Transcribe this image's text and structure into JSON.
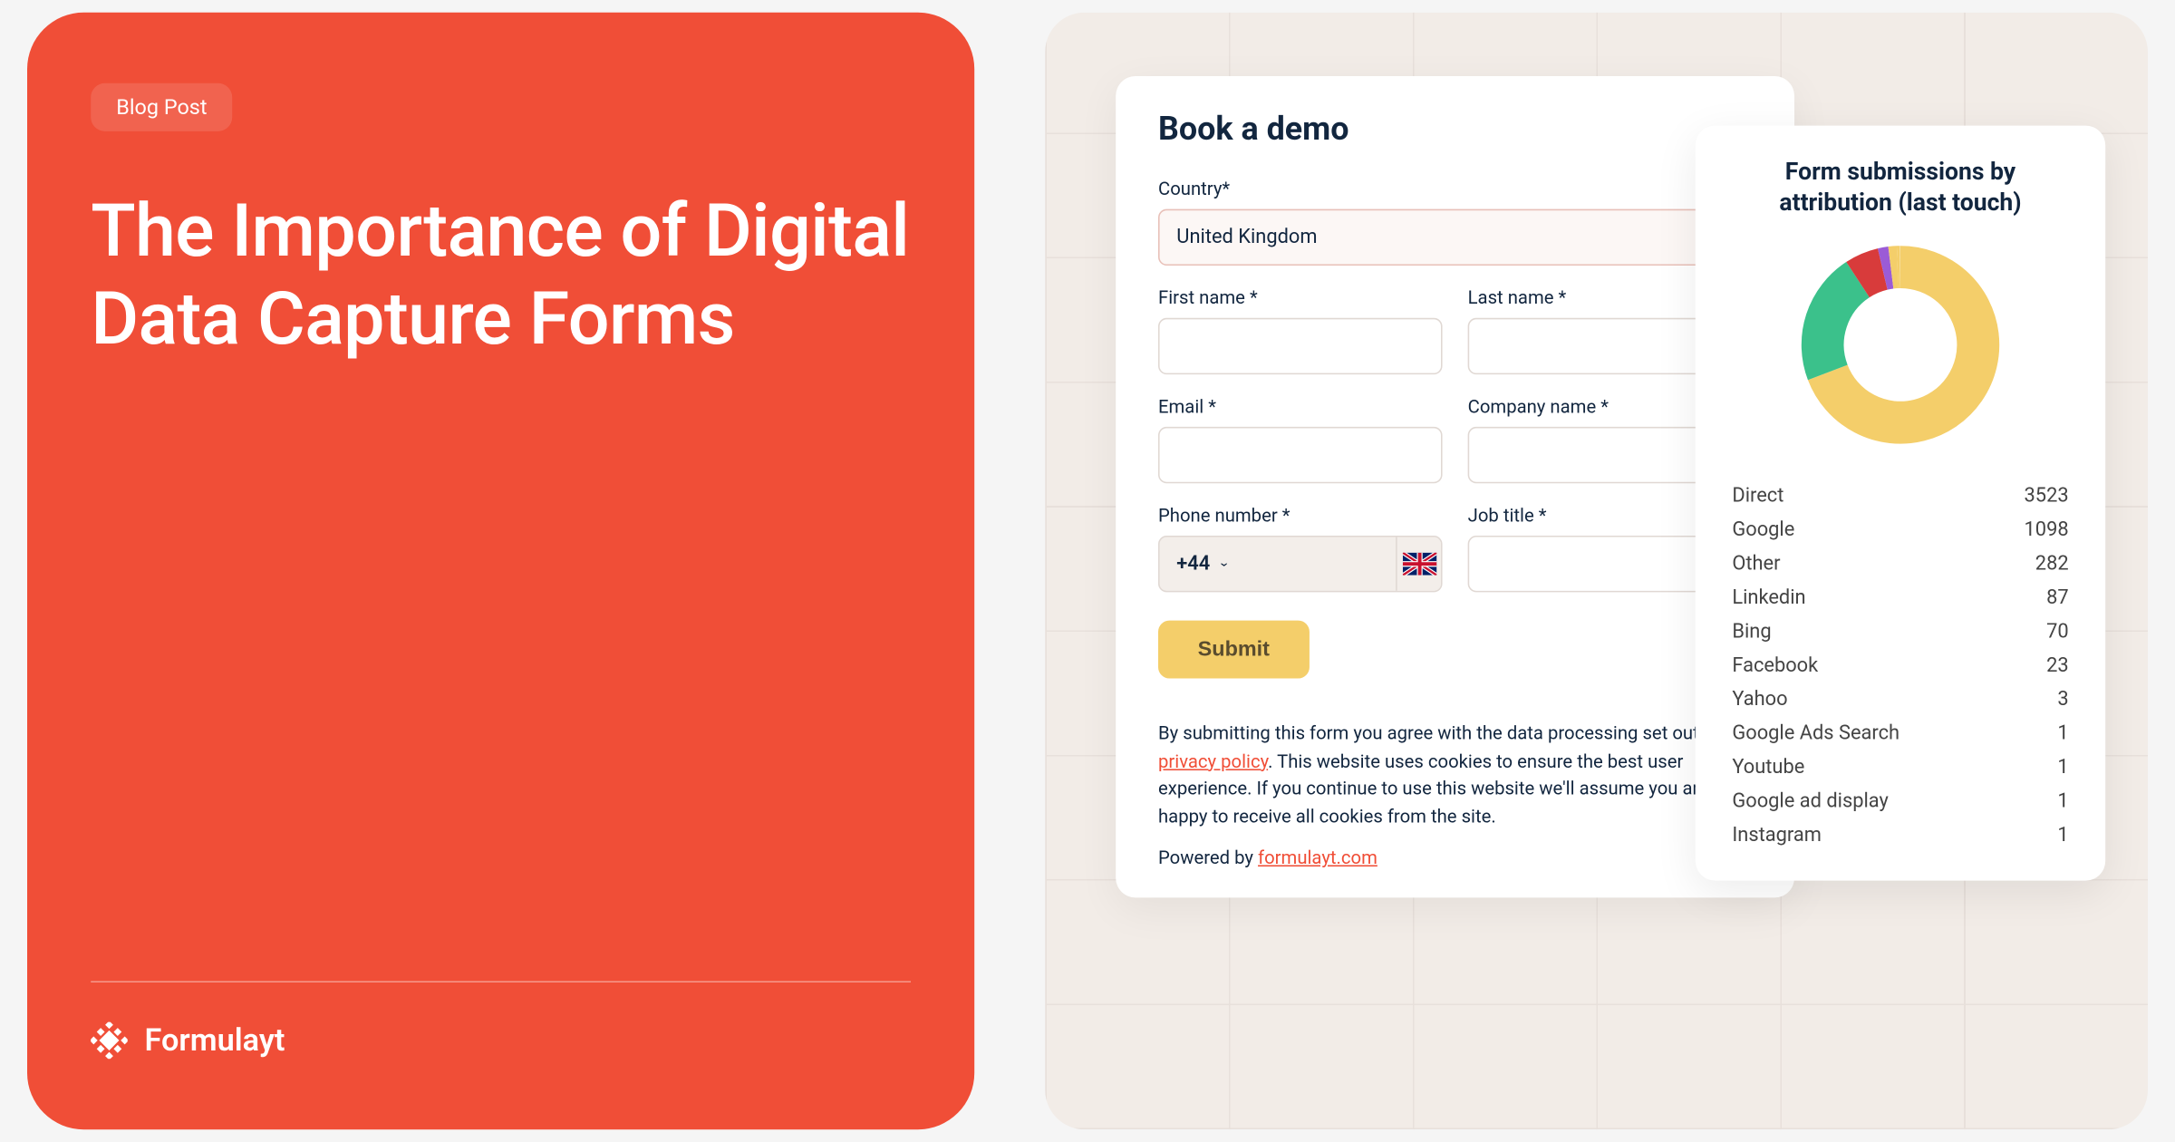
{
  "left": {
    "badge": "Blog Post",
    "title": "The Importance of Digital Data Capture Forms",
    "logo": "Formulayt"
  },
  "form": {
    "title": "Book a demo",
    "country_label": "Country*",
    "country_value": "United Kingdom",
    "first_name_label": "First name *",
    "last_name_label": "Last name *",
    "email_label": "Email *",
    "company_label": "Company name *",
    "phone_label": "Phone number *",
    "phone_code": "+44",
    "job_title_label": "Job title *",
    "submit": "Submit",
    "disclaimer_1": "By submitting this form you agree with the data processing set out in our ",
    "privacy_link": "privacy policy",
    "disclaimer_2": ". This website uses cookies to ensure the best user experience. If you continue to use this website we'll assume you are happy to receive all cookies from the site.",
    "powered_prefix": "Powered by ",
    "powered_link": "formulayt.com"
  },
  "stats": {
    "title": "Form submissions by attribution (last touch)",
    "rows": [
      {
        "label": "Direct",
        "value": "3523"
      },
      {
        "label": "Google",
        "value": "1098"
      },
      {
        "label": "Other",
        "value": "282"
      },
      {
        "label": "Linkedin",
        "value": "87"
      },
      {
        "label": "Bing",
        "value": "70"
      },
      {
        "label": "Facebook",
        "value": "23"
      },
      {
        "label": "Yahoo",
        "value": "3"
      },
      {
        "label": "Google Ads Search",
        "value": "1"
      },
      {
        "label": "Youtube",
        "value": "1"
      },
      {
        "label": "Google ad display",
        "value": "1"
      },
      {
        "label": "Instagram",
        "value": "1"
      }
    ]
  },
  "chart_data": {
    "type": "pie",
    "title": "Form submissions by attribution (last touch)",
    "categories": [
      "Direct",
      "Google",
      "Other",
      "Linkedin",
      "Bing",
      "Facebook",
      "Yahoo",
      "Google Ads Search",
      "Youtube",
      "Google ad display",
      "Instagram"
    ],
    "values": [
      3523,
      1098,
      282,
      87,
      70,
      23,
      3,
      1,
      1,
      1,
      1
    ],
    "colors": [
      "#f4ce6a",
      "#3bc18b",
      "#d83b3b",
      "#9b5bd6",
      "#f4ce6a",
      "#f4ce6a",
      "#f4ce6a",
      "#f4ce6a",
      "#f4ce6a",
      "#f4ce6a",
      "#f4ce6a"
    ]
  }
}
